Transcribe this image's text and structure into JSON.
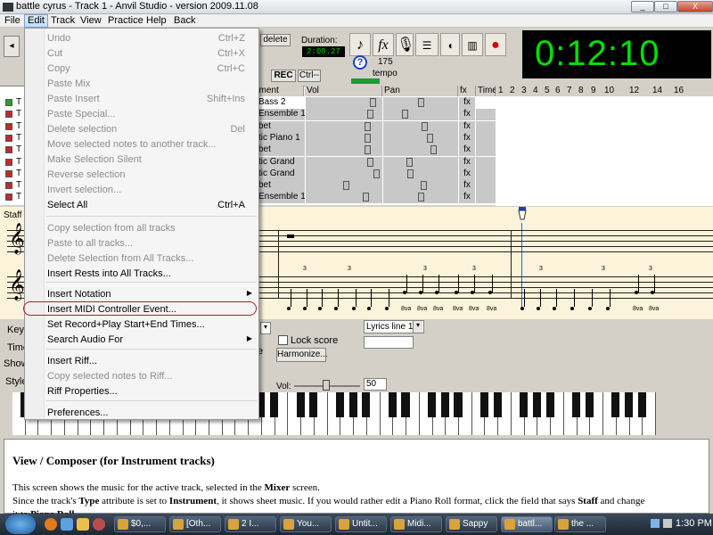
{
  "window": {
    "title": "battle cyrus - Track 1 - Anvil Studio - version 2009.11.08",
    "controls": [
      "_",
      "□",
      "X"
    ]
  },
  "menubar": {
    "items": [
      "File",
      "Edit",
      "Track",
      "View",
      "Practice",
      "Help",
      "Back"
    ]
  },
  "toolbar": {
    "delete_label": "delete",
    "duration_label": "Duration:",
    "duration_value": "2:08.27",
    "tempo_value": "175",
    "tempo_label": "tempo",
    "rec_label": "REC",
    "ctrl_label": "Ctrl--",
    "clock": "0:12:10"
  },
  "edit_menu": {
    "items": [
      {
        "label": "Undo",
        "shortcut": "Ctrl+Z",
        "enabled": false
      },
      {
        "label": "Cut",
        "shortcut": "Ctrl+X",
        "enabled": false
      },
      {
        "label": "Copy",
        "shortcut": "Ctrl+C",
        "enabled": false
      },
      {
        "label": "Paste Mix",
        "shortcut": "",
        "enabled": false
      },
      {
        "label": "Paste Insert",
        "shortcut": "Shift+Ins",
        "enabled": false
      },
      {
        "label": "Paste Special...",
        "shortcut": "",
        "enabled": false
      },
      {
        "label": "Delete selection",
        "shortcut": "Del",
        "enabled": false
      },
      {
        "label": "Move selected notes to another track...",
        "shortcut": "",
        "enabled": false
      },
      {
        "label": "Make Selection Silent",
        "shortcut": "",
        "enabled": false
      },
      {
        "label": "Reverse selection",
        "shortcut": "",
        "enabled": false
      },
      {
        "label": "Invert selection...",
        "shortcut": "",
        "enabled": false
      },
      {
        "label": "Select All",
        "shortcut": "Ctrl+A",
        "enabled": true
      },
      {
        "label": "Copy selection from all tracks",
        "shortcut": "",
        "enabled": false
      },
      {
        "label": "Paste to all tracks...",
        "shortcut": "",
        "enabled": false
      },
      {
        "label": "Delete Selection from All Tracks...",
        "shortcut": "",
        "enabled": false
      },
      {
        "label": "Insert Rests into All Tracks...",
        "shortcut": "",
        "enabled": true
      },
      {
        "label": "Insert Notation",
        "shortcut": "",
        "enabled": true,
        "submenu": true
      },
      {
        "label": "Insert MIDI Controller Event...",
        "shortcut": "",
        "enabled": true
      },
      {
        "label": "Set Record+Play Start+End Times...",
        "shortcut": "",
        "enabled": true
      },
      {
        "label": "Search Audio For",
        "shortcut": "",
        "enabled": true,
        "submenu": true
      },
      {
        "label": "Insert Riff...",
        "shortcut": "",
        "enabled": true
      },
      {
        "label": "Copy selected notes to Riff...",
        "shortcut": "",
        "enabled": false
      },
      {
        "label": "Riff Properties...",
        "shortcut": "",
        "enabled": true
      },
      {
        "label": "Preferences...",
        "shortcut": "",
        "enabled": true
      }
    ]
  },
  "track_grid": {
    "headers": [
      "ument",
      "Vol",
      "Pan",
      "fx",
      "Time"
    ],
    "measures": [
      "1",
      "2",
      "3",
      "4",
      "5",
      "6",
      "7",
      "8",
      "9",
      "10",
      "12",
      "14",
      "16"
    ],
    "tracks": [
      {
        "name": "Bass 2",
        "vol": 0.9,
        "pan": 0.5
      },
      {
        "name": "Ensemble 1",
        "vol": 0.86,
        "pan": 0.27
      },
      {
        "name": "bet",
        "vol": 0.82,
        "pan": 0.55
      },
      {
        "name": "tic Piano 1",
        "vol": 0.83,
        "pan": 0.63
      },
      {
        "name": "bet",
        "vol": 0.82,
        "pan": 0.68
      },
      {
        "name": "tic Grand",
        "vol": 0.86,
        "pan": 0.33
      },
      {
        "name": "tic Grand",
        "vol": 0.95,
        "pan": 0.35
      },
      {
        "name": "bet",
        "vol": 0.52,
        "pan": 0.54
      },
      {
        "name": "Ensemble 1",
        "vol": 0.8,
        "pan": 0.5
      }
    ]
  },
  "staff": {
    "label": "Staff",
    "triplet": "3",
    "octave_marks": [
      "8va",
      "8va",
      "8va",
      "8va",
      "8va",
      "8va",
      "8va",
      "8va"
    ]
  },
  "lower_panel": {
    "left_labels": [
      "Key",
      "Time",
      "Show",
      "Style"
    ],
    "lyrics_select": "Lyrics line 1",
    "lock_score_label": "Lock score",
    "harmonize_label": "Harmonize...",
    "vol_label": "Vol:",
    "vol_value": "50",
    "e_label": "e"
  },
  "help": {
    "title": "View / Composer (for Instrument tracks)",
    "line1_pre": "This screen shows the music for the active track, selected in the ",
    "line1_bold": "Mixer",
    "line1_post": " screen.",
    "line2_a": "Since the track's ",
    "line2_b": "Type",
    "line2_c": " attribute is set to ",
    "line2_d": "Instrument",
    "line2_e": ", it shows sheet music. If you would rather edit a Piano Roll format, click the field that says ",
    "line2_f": "Staff",
    "line2_g": " and change",
    "line3_a": "it to ",
    "line3_b": "Piano Roll",
    "line3_c": "."
  },
  "taskbar": {
    "tasks": [
      "$0,...",
      "[Oth...",
      "2 I...",
      "You...",
      "Untit...",
      "Midi...",
      "Sappy",
      "battl...",
      "the ..."
    ],
    "time": "1:30 PM"
  },
  "colors": {
    "clock_green": "#00e000",
    "staff_bg": "#fbf3da",
    "menu_highlight": "#b02020"
  }
}
